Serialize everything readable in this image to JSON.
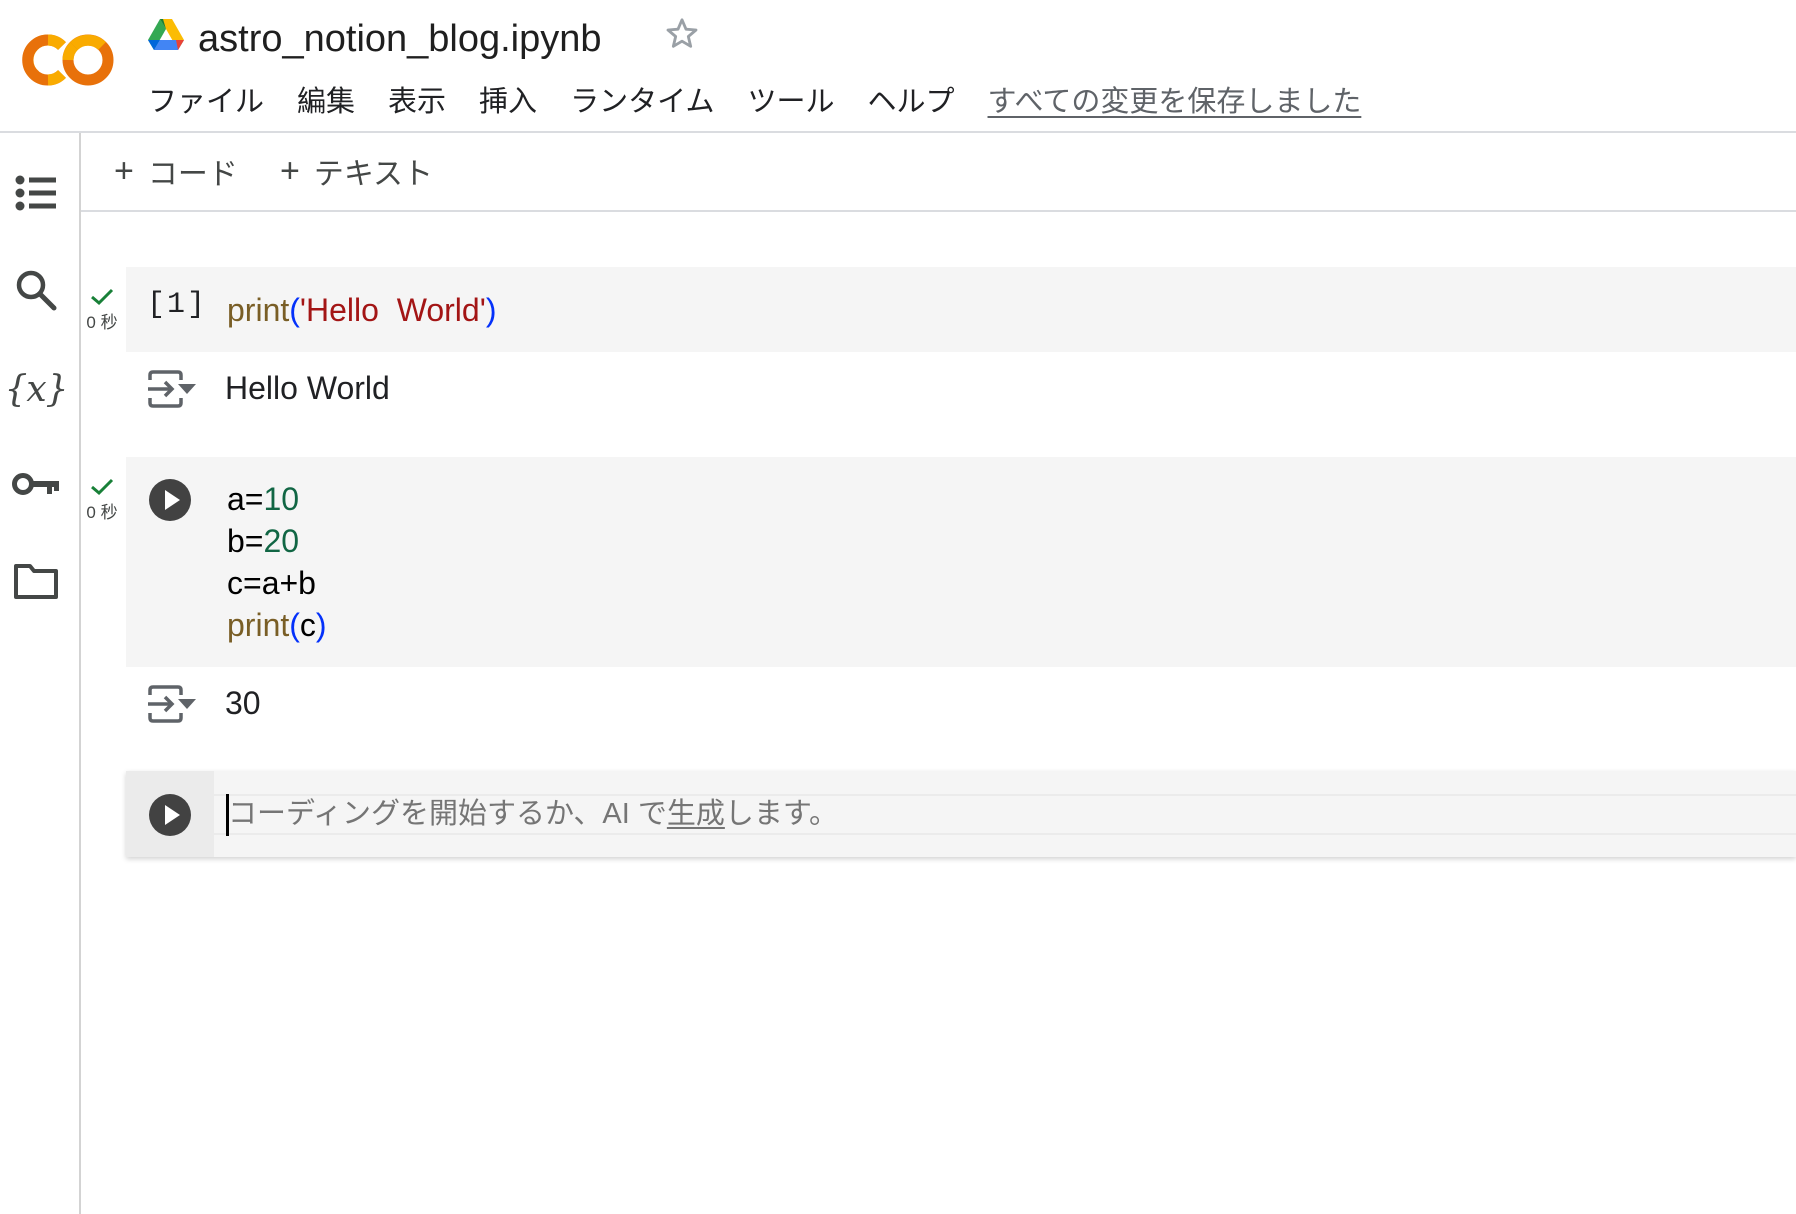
{
  "app": {
    "logo": "colab-logo",
    "drive_icon": "google-drive-icon",
    "title": "astro_notion_blog.ipynb",
    "star_icon": "star-outline-icon"
  },
  "menu": {
    "items": [
      {
        "label": "ファイル"
      },
      {
        "label": "編集"
      },
      {
        "label": "表示"
      },
      {
        "label": "挿入"
      },
      {
        "label": "ランタイム"
      },
      {
        "label": "ツール"
      },
      {
        "label": "ヘルプ"
      }
    ],
    "save_status": "すべての変更を保存しました"
  },
  "sidebar": {
    "items": [
      {
        "name": "table-of-contents",
        "icon": "list-icon"
      },
      {
        "name": "search",
        "icon": "search-icon"
      },
      {
        "name": "variables",
        "icon": "variables-icon",
        "glyph": "{x}"
      },
      {
        "name": "secrets",
        "icon": "key-icon"
      },
      {
        "name": "files",
        "icon": "folder-icon"
      }
    ]
  },
  "toolbar": {
    "add_code_plus": "+",
    "add_code_label": "コード",
    "add_text_plus": "+",
    "add_text_label": "テキスト"
  },
  "cells": [
    {
      "type": "code",
      "status": "success",
      "exec_time": "0 秒",
      "exec_count": "[1]",
      "code_tokens": [
        [
          {
            "t": "print",
            "k": "fn"
          },
          {
            "t": "(",
            "k": "paren"
          },
          {
            "t": "'Hello  World'",
            "k": "str"
          },
          {
            "t": ")",
            "k": "paren"
          }
        ]
      ],
      "output": "Hello World"
    },
    {
      "type": "code",
      "status": "success",
      "exec_time": "0 秒",
      "exec_count": "",
      "code_tokens": [
        [
          {
            "t": "a=",
            "k": "plain"
          },
          {
            "t": "10",
            "k": "num"
          }
        ],
        [
          {
            "t": "b=",
            "k": "plain"
          },
          {
            "t": "20",
            "k": "num"
          }
        ],
        [
          {
            "t": "c=a+b",
            "k": "plain"
          }
        ],
        [
          {
            "t": "print",
            "k": "fn"
          },
          {
            "t": "(",
            "k": "paren"
          },
          {
            "t": "c",
            "k": "plain"
          },
          {
            "t": ")",
            "k": "paren"
          }
        ]
      ],
      "output": "30"
    },
    {
      "type": "code",
      "focused": true,
      "placeholder_before": "コーディングを開始するか、AI で",
      "placeholder_link": "生成",
      "placeholder_after": "します。"
    }
  ],
  "colors": {
    "success_check": "#188038",
    "run_button": "#424242",
    "cell_bg": "#f5f5f5",
    "logo_light": "#f9ab00",
    "logo_dark": "#e8710a"
  }
}
